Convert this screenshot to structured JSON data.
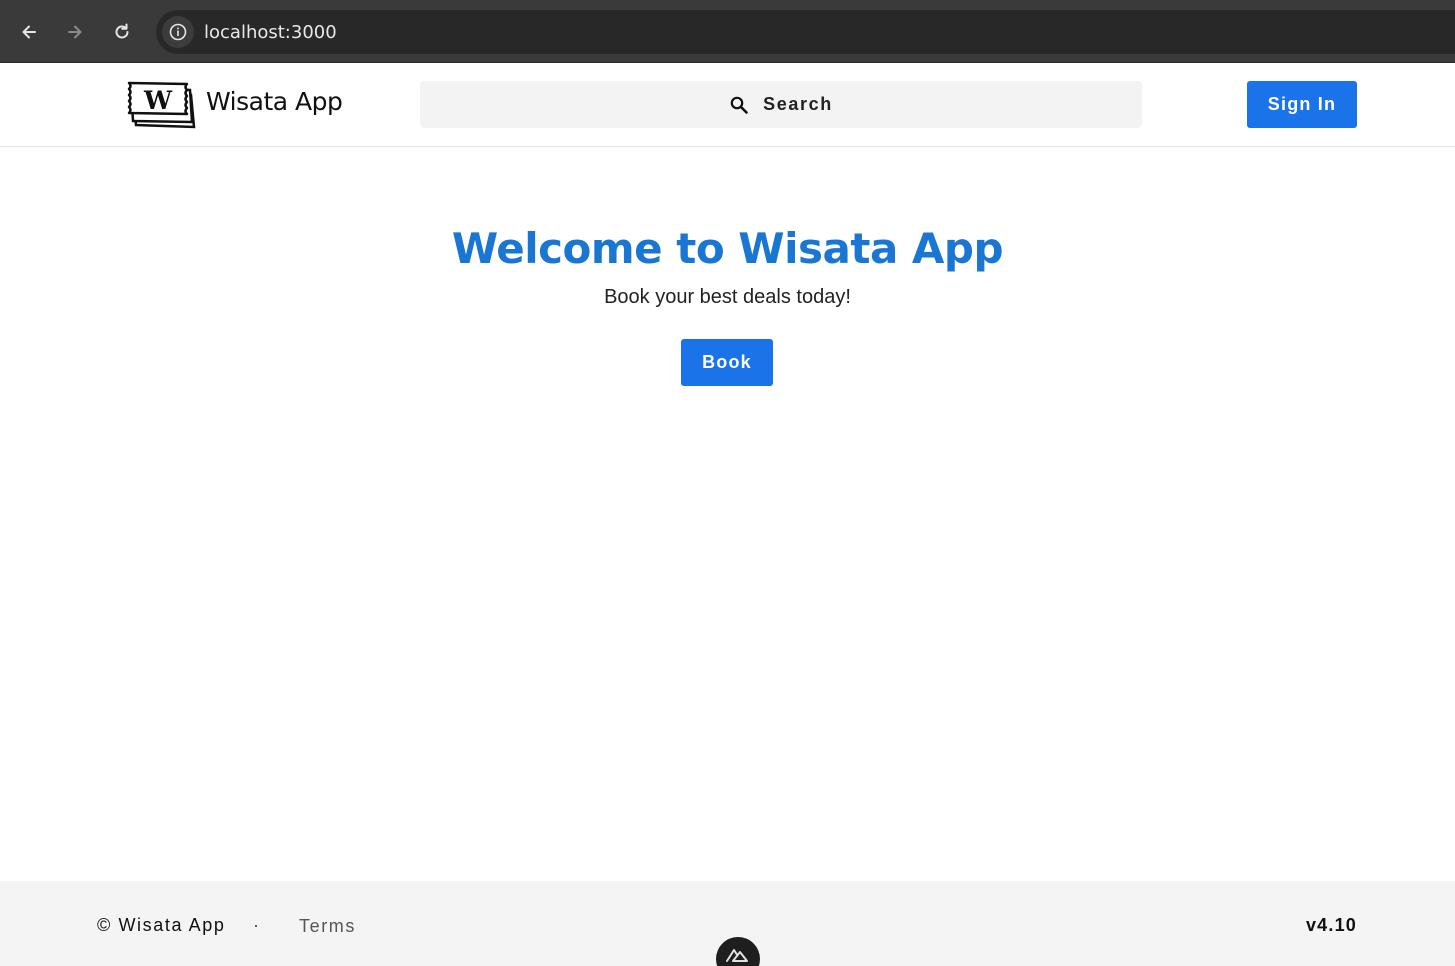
{
  "browser": {
    "url": "localhost:3000",
    "icons": {
      "back": "arrow-left-icon",
      "forward": "arrow-right-icon",
      "reload": "reload-icon",
      "site_info": "info-icon"
    }
  },
  "header": {
    "brand_name": "Wisata App",
    "logo_letter": "W",
    "search_label": "Search",
    "sign_in_label": "Sign In"
  },
  "hero": {
    "title": "Welcome to Wisata App",
    "subtitle": "Book your best deals today!",
    "book_label": "Book"
  },
  "footer": {
    "copyright": "© Wisata App",
    "separator": "·",
    "terms_label": "Terms",
    "version": "v4.10"
  },
  "colors": {
    "accent": "#1a73e8",
    "title": "#1976d2",
    "browser_bar": "#3a3a3a",
    "footer_bg": "#f4f4f4"
  }
}
